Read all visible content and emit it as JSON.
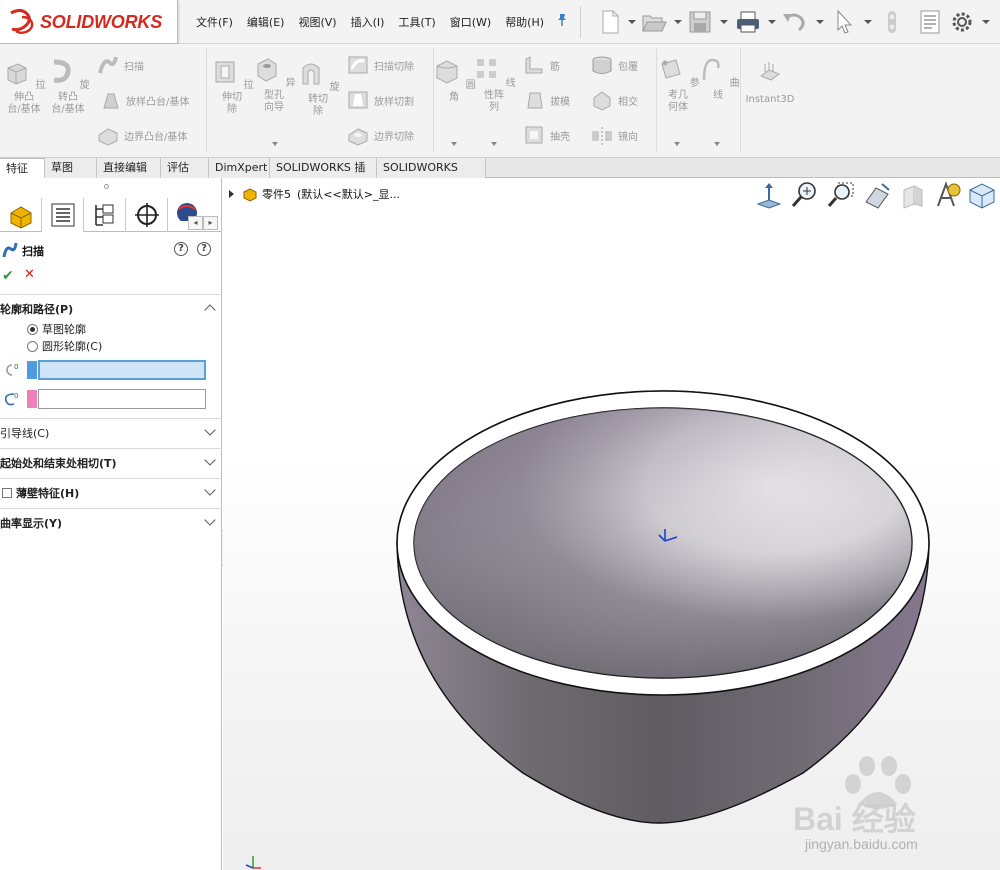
{
  "app": {
    "brand": "SOLIDWORKS",
    "brand_color": "#d52b1e"
  },
  "menu": [
    "文件(F)",
    "编辑(E)",
    "视图(V)",
    "插入(I)",
    "工具(T)",
    "窗口(W)",
    "帮助(H)"
  ],
  "quick_toolbar": [
    "new-document-icon",
    "open-icon",
    "save-icon",
    "print-icon",
    "undo-icon",
    "select-icon",
    "rebuild-icon",
    "file-properties-icon",
    "options-gear-icon"
  ],
  "ribbon": {
    "extrude_boss": "拉伸凸\n台/基体",
    "revolve_boss": "旋转凸\n台/基体",
    "sweep": "扫描",
    "loft_boss": "放样凸台/基体",
    "boundary_boss": "边界凸台/基体",
    "extrude_cut": "拉伸切\n除",
    "hole_wizard": "异型孔\n向导",
    "revolve_cut": "旋转切\n除",
    "swept_cut": "扫描切除",
    "lofted_cut": "放样切割",
    "boundary_cut": "边界切除",
    "fillet": "圆角",
    "linear_pattern": "线性阵\n列",
    "rib": "筋",
    "draft": "拔模",
    "shell": "抽壳",
    "wrap": "包覆",
    "intersect": "相交",
    "mirror": "镜向",
    "reference_geometry": "参考几\n何体",
    "curves": "曲线",
    "instant3d": "Instant3D"
  },
  "tabs": [
    "特征",
    "草图",
    "直接编辑",
    "评估",
    "DimXpert",
    "SOLIDWORKS 插件",
    "SOLIDWORKS MBD"
  ],
  "property_manager": {
    "title": "扫描",
    "help_icon_1": "?",
    "help_icon_2": "?",
    "ok": "✔",
    "cancel": "✕",
    "profile_path_section": "轮廓和路径(P)",
    "sketch_profile": "草图轮廓",
    "circular_profile": "圆形轮廓(C)",
    "profile_selection": "",
    "path_selection": "",
    "guide_curves": "引导线(C)",
    "tangency": "起始处和结束处相切(T)",
    "thin_feature": "薄壁特征(H)",
    "curvature_display": "曲率显示(Y)",
    "profile_color": "#4e9be0",
    "path_color": "#f080b8"
  },
  "tree": {
    "part_label": "零件5",
    "config_label": "(默认<<默认>_显..."
  },
  "watermark": {
    "text": "Bai 经验",
    "url": "jingyan.baidu.com"
  }
}
